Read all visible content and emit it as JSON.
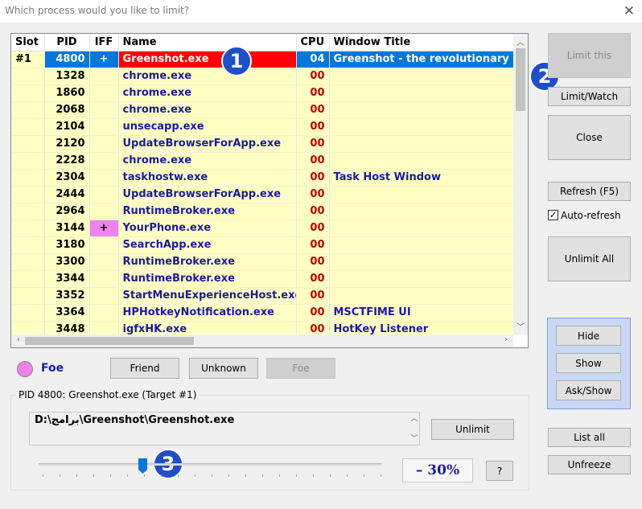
{
  "window": {
    "title": "Which process would you like to limit?"
  },
  "list": {
    "columns": {
      "slot": "Slot",
      "pid": "PID",
      "iff": "IFF",
      "name": "Name",
      "cpu": "CPU",
      "window_title": "Window Title"
    },
    "rows": [
      {
        "slot": "#1",
        "pid": "4800",
        "iff": "+",
        "name": "Greenshot.exe",
        "cpu": "04",
        "window_title": "Greenshot - the revolutionary screenshot tool",
        "selected": true
      },
      {
        "slot": "",
        "pid": "1328",
        "iff": "",
        "name": "chrome.exe",
        "cpu": "00",
        "window_title": ""
      },
      {
        "slot": "",
        "pid": "1860",
        "iff": "",
        "name": "chrome.exe",
        "cpu": "00",
        "window_title": ""
      },
      {
        "slot": "",
        "pid": "2068",
        "iff": "",
        "name": "chrome.exe",
        "cpu": "00",
        "window_title": ""
      },
      {
        "slot": "",
        "pid": "2104",
        "iff": "",
        "name": "unsecapp.exe",
        "cpu": "00",
        "window_title": ""
      },
      {
        "slot": "",
        "pid": "2120",
        "iff": "",
        "name": "UpdateBrowserForApp.exe",
        "cpu": "00",
        "window_title": ""
      },
      {
        "slot": "",
        "pid": "2228",
        "iff": "",
        "name": "chrome.exe",
        "cpu": "00",
        "window_title": ""
      },
      {
        "slot": "",
        "pid": "2304",
        "iff": "",
        "name": "taskhostw.exe",
        "cpu": "00",
        "window_title": "Task Host Window"
      },
      {
        "slot": "",
        "pid": "2444",
        "iff": "",
        "name": "UpdateBrowserForApp.exe",
        "cpu": "00",
        "window_title": ""
      },
      {
        "slot": "",
        "pid": "2964",
        "iff": "",
        "name": "RuntimeBroker.exe",
        "cpu": "00",
        "window_title": ""
      },
      {
        "slot": "",
        "pid": "3144",
        "iff": "+",
        "name": "YourPhone.exe",
        "cpu": "00",
        "window_title": "",
        "iff_highlight": true
      },
      {
        "slot": "",
        "pid": "3180",
        "iff": "",
        "name": "SearchApp.exe",
        "cpu": "00",
        "window_title": ""
      },
      {
        "slot": "",
        "pid": "3300",
        "iff": "",
        "name": "RuntimeBroker.exe",
        "cpu": "00",
        "window_title": ""
      },
      {
        "slot": "",
        "pid": "3344",
        "iff": "",
        "name": "RuntimeBroker.exe",
        "cpu": "00",
        "window_title": ""
      },
      {
        "slot": "",
        "pid": "3352",
        "iff": "",
        "name": "StartMenuExperienceHost.exe",
        "cpu": "00",
        "window_title": ""
      },
      {
        "slot": "",
        "pid": "3364",
        "iff": "",
        "name": "HPHotkeyNotification.exe",
        "cpu": "00",
        "window_title": "MSCTFIME UI"
      },
      {
        "slot": "",
        "pid": "3448",
        "iff": "",
        "name": "igfxHK.exe",
        "cpu": "00",
        "window_title": "HotKey Listener"
      }
    ]
  },
  "badges": {
    "one": "1",
    "two": "2",
    "three": "3"
  },
  "iff_status": {
    "label": "Foe",
    "dot_color": "#ee82ee"
  },
  "iff_buttons": {
    "friend": "Friend",
    "unknown": "Unknown",
    "foe": "Foe"
  },
  "target": {
    "group_label": "PID 4800: Greenshot.exe (Target #1)",
    "path": "D:\\برامج\\Greenshot\\Greenshot.exe",
    "unlimit": "Unlimit",
    "percent_text": "– 30%",
    "help": "?",
    "slider_level_percent": 30
  },
  "sidebar": {
    "limit_this": "Limit this",
    "limit_watch": "Limit/Watch",
    "close": "Close",
    "refresh": "Refresh (F5)",
    "auto_refresh": "Auto-refresh",
    "auto_refresh_checked": true,
    "unlimit_all": "Unlimit All",
    "hide": "Hide",
    "show": "Show",
    "ask_show": "Ask/Show",
    "list_all": "List all",
    "unfreeze": "Unfreeze"
  },
  "colors": {
    "selection": "#0078d7",
    "selected_name": "#ff0000",
    "row_bg": "#ffffc4",
    "badge": "#1e4fc8"
  }
}
